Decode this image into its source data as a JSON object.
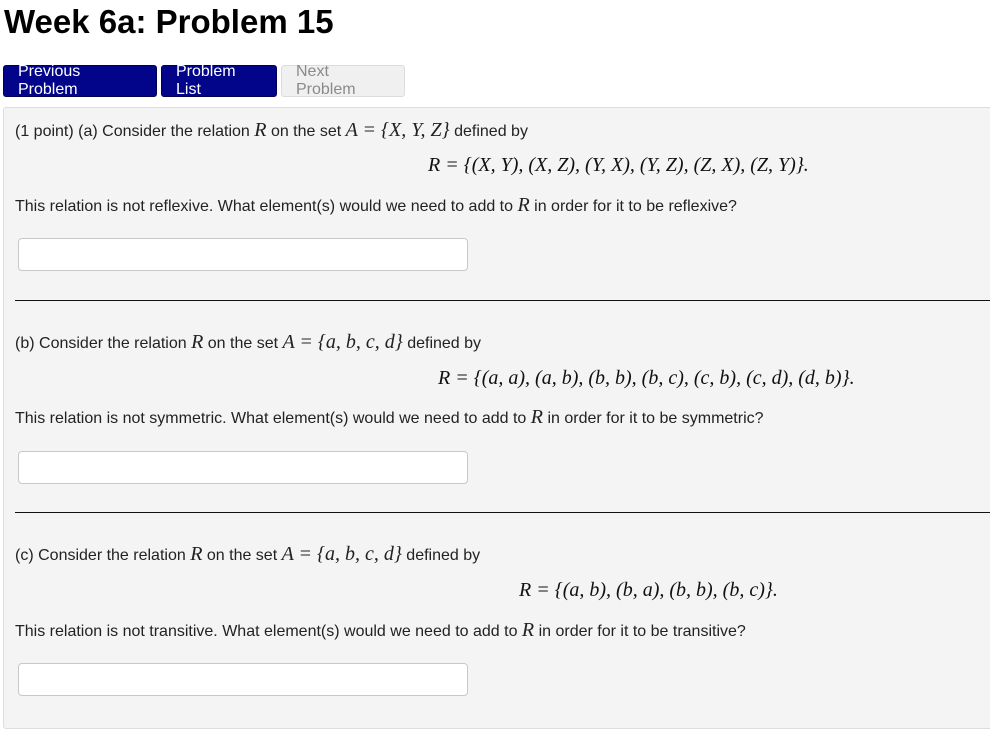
{
  "page": {
    "title": "Week 6a: Problem 15"
  },
  "nav": {
    "previous_label": "Previous Problem",
    "list_label": "Problem List",
    "next_label": "Next Problem",
    "primary_color": "#02058a"
  },
  "problem": {
    "points": "(1 point)",
    "parts": [
      {
        "label": "(a)",
        "intro_before": "Consider the relation",
        "relation_symbol": "R",
        "intro_middle": "on the set",
        "set_expr": "A = {X, Y, Z}",
        "intro_after": "defined by",
        "relation_def": "R = {(X, Y), (X, Z), (Y, X), (Y, Z), (Z, X), (Z, Y)}.",
        "question_before": "This relation is not reflexive. What element(s) would we need to add to",
        "question_after": "in order for it to be reflexive?",
        "answer_value": ""
      },
      {
        "label": "(b)",
        "intro_before": "Consider the relation",
        "relation_symbol": "R",
        "intro_middle": "on the set",
        "set_expr": "A = {a, b, c, d}",
        "intro_after": "defined by",
        "relation_def": "R = {(a, a), (a, b), (b, b), (b, c), (c, b), (c, d), (d, b)}.",
        "question_before": "This relation is not symmetric. What element(s) would we need to add to",
        "question_after": "in order for it to be symmetric?",
        "answer_value": ""
      },
      {
        "label": "(c)",
        "intro_before": "Consider the relation",
        "relation_symbol": "R",
        "intro_middle": "on the set",
        "set_expr": "A = {a, b, c, d}",
        "intro_after": "defined by",
        "relation_def": "R = {(a, b), (b, a), (b, b), (b, c)}.",
        "question_before": "This relation is not transitive. What element(s) would we need to add to",
        "question_after": "in order for it to be transitive?",
        "answer_value": ""
      }
    ]
  }
}
